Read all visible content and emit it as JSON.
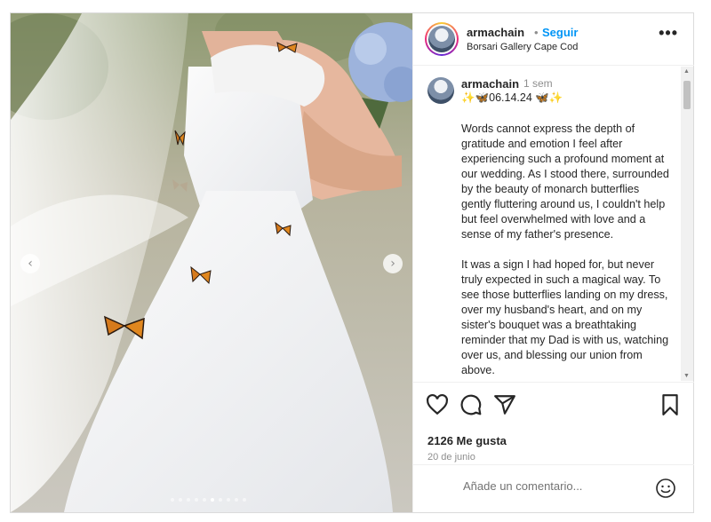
{
  "post": {
    "username": "armachain",
    "separator": "•",
    "follow_label": "Seguir",
    "location": "Borsari Gallery Cape Cod",
    "more_label": "•••"
  },
  "caption": {
    "username": "armachain",
    "time_ago": "1 sem",
    "date_line": "✨🦋06.14.24 🦋✨",
    "paragraphs": [
      "Words cannot express the depth of gratitude and emotion I feel after experiencing such a profound moment at our wedding. As I stood there, surrounded by the beauty of monarch butterflies gently fluttering around us, I couldn't help but feel overwhelmed with love and a sense of my father's presence.",
      "It was a sign I had hoped for, but never truly expected in such a magical way. To see those butterflies landing on my dress, over my husband's heart, and on my sister's bouquet was a breathtaking reminder that my Dad is with us, watching over us, and blessing our union from above."
    ]
  },
  "media": {
    "prev_arrow": "‹",
    "next_arrow": "›",
    "dot_count": 10,
    "active_dot": 5
  },
  "actions": {
    "likes": "2126 Me gusta",
    "date": "20 de junio"
  },
  "comment": {
    "placeholder": "Añade un comentario..."
  },
  "icons": {
    "like": "heart-icon",
    "comment": "comment-icon",
    "share": "share-icon",
    "save": "bookmark-icon",
    "emoji": "emoji-icon"
  },
  "colors": {
    "follow": "#0095f6",
    "secondary_text": "#8e8e8e",
    "border": "#dbdbdb"
  }
}
